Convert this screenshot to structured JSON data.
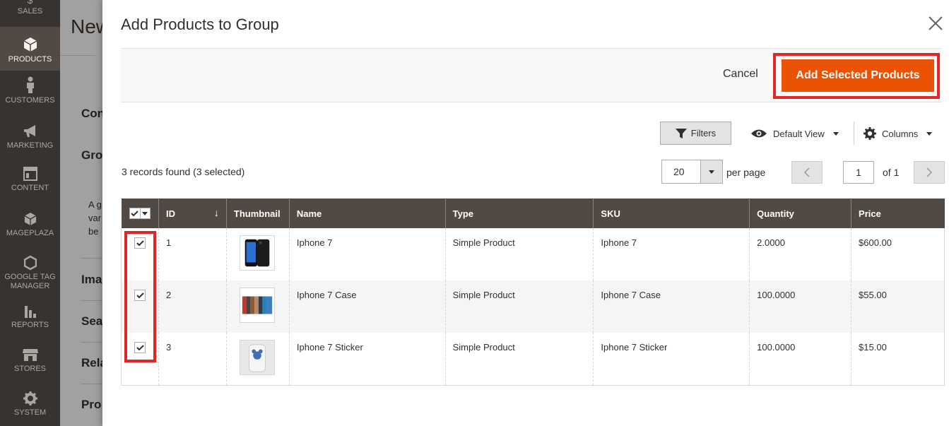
{
  "sidebar": {
    "items": [
      {
        "label": "Sales",
        "icon": "dollar-icon"
      },
      {
        "label": "Products",
        "icon": "cube-icon",
        "active": true
      },
      {
        "label": "Customers",
        "icon": "person-icon"
      },
      {
        "label": "Marketing",
        "icon": "megaphone-icon"
      },
      {
        "label": "Content",
        "icon": "layout-icon"
      },
      {
        "label": "Mageplaza",
        "icon": "cube-icon"
      },
      {
        "label": "Google Tag Manager",
        "line1": "Google Tag",
        "line2": "Manager",
        "icon": "hexagon-icon"
      },
      {
        "label": "Reports",
        "icon": "bar-chart-icon"
      },
      {
        "label": "Stores",
        "icon": "store-icon"
      },
      {
        "label": "System",
        "icon": "gear-icon"
      }
    ]
  },
  "background_page": {
    "title": "New",
    "sections": [
      "Con",
      "Gro",
      "Ima",
      "Sea",
      "Rela",
      "Pro"
    ],
    "text_lines": [
      "A g",
      "var",
      "be"
    ]
  },
  "modal": {
    "title": "Add Products to Group",
    "cancel_label": "Cancel",
    "add_label": "Add Selected Products",
    "accent_color": "#eb5202",
    "highlight_color": "#e22626"
  },
  "toolbar": {
    "filters_label": "Filters",
    "view_label": "Default View",
    "columns_label": "Columns",
    "records_text": "3 records found (3 selected)",
    "per_page_value": "20",
    "per_page_label": "per page",
    "page_value": "1",
    "page_of": "of 1"
  },
  "grid": {
    "columns": [
      "ID",
      "Thumbnail",
      "Name",
      "Type",
      "SKU",
      "Quantity",
      "Price"
    ],
    "rows": [
      {
        "id": "1",
        "name": "Iphone 7",
        "type": "Simple Product",
        "sku": "Iphone 7",
        "quantity": "2.0000",
        "price": "$600.00",
        "checked": true
      },
      {
        "id": "2",
        "name": "Iphone 7 Case",
        "type": "Simple Product",
        "sku": "Iphone 7 Case",
        "quantity": "100.0000",
        "price": "$55.00",
        "checked": true
      },
      {
        "id": "3",
        "name": "Iphone 7 Sticker",
        "type": "Simple Product",
        "sku": "Iphone 7 Sticker",
        "quantity": "100.0000",
        "price": "$15.00",
        "checked": true
      }
    ]
  }
}
